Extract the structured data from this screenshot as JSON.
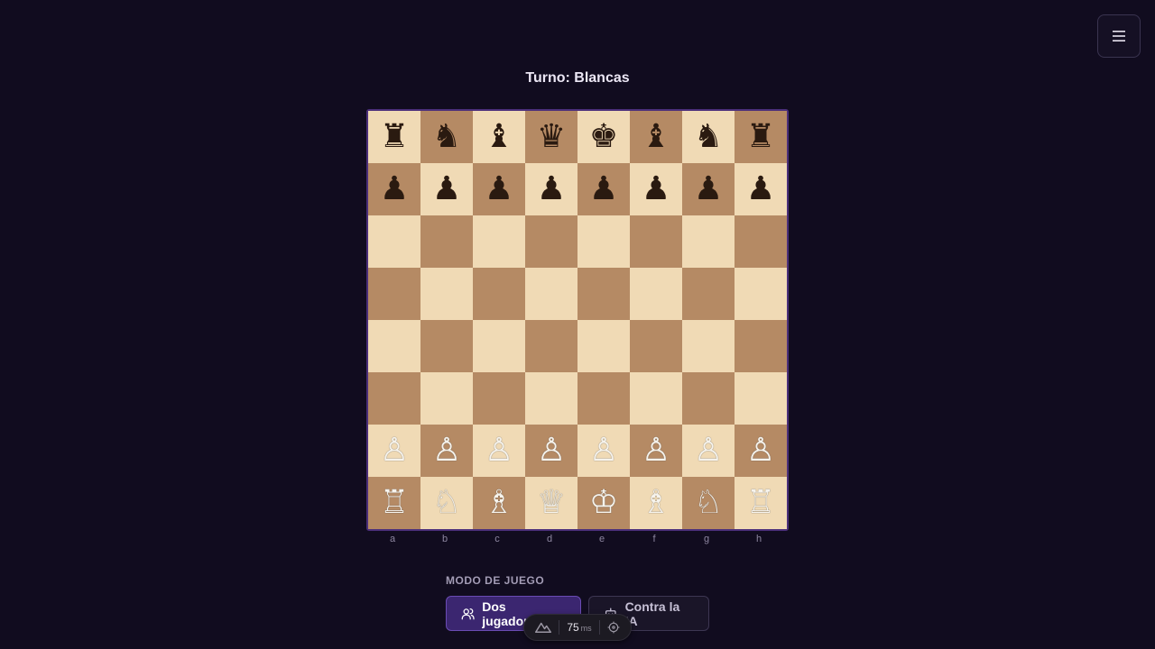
{
  "header": {
    "turn_label": "Turno: Blancas",
    "menu_icon": "hamburger-menu-icon"
  },
  "board": {
    "ranks": [
      [
        "♜",
        "♞",
        "♝",
        "♛",
        "♚",
        "♝",
        "♞",
        "♜"
      ],
      [
        "♟",
        "♟",
        "♟",
        "♟",
        "♟",
        "♟",
        "♟",
        "♟"
      ],
      [
        "",
        "",
        "",
        "",
        "",
        "",
        "",
        ""
      ],
      [
        "",
        "",
        "",
        "",
        "",
        "",
        "",
        ""
      ],
      [
        "",
        "",
        "",
        "",
        "",
        "",
        "",
        ""
      ],
      [
        "",
        "",
        "",
        "",
        "",
        "",
        "",
        ""
      ],
      [
        "♙",
        "♙",
        "♙",
        "♙",
        "♙",
        "♙",
        "♙",
        "♙"
      ],
      [
        "♖",
        "♘",
        "♗",
        "♕",
        "♔",
        "♗",
        "♘",
        "♖"
      ]
    ],
    "piece_colors": [
      [
        "black",
        "black",
        "black",
        "black",
        "black",
        "black",
        "black",
        "black"
      ],
      [
        "black",
        "black",
        "black",
        "black",
        "black",
        "black",
        "black",
        "black"
      ],
      [
        "",
        "",
        "",
        "",
        "",
        "",
        "",
        ""
      ],
      [
        "",
        "",
        "",
        "",
        "",
        "",
        "",
        ""
      ],
      [
        "",
        "",
        "",
        "",
        "",
        "",
        "",
        ""
      ],
      [
        "",
        "",
        "",
        "",
        "",
        "",
        "",
        ""
      ],
      [
        "white",
        "white",
        "white",
        "white",
        "white",
        "white",
        "white",
        "white"
      ],
      [
        "white",
        "white",
        "white",
        "white",
        "white",
        "white",
        "white",
        "white"
      ]
    ],
    "files": [
      "a",
      "b",
      "c",
      "d",
      "e",
      "f",
      "g",
      "h"
    ],
    "colors": {
      "light": "#f0dab5",
      "dark": "#b58a64",
      "border": "#4b2f7a"
    }
  },
  "mode": {
    "label": "MODO DE JUEGO",
    "two_players": "Dos jugadores",
    "vs_ai": "Contra la IA",
    "two_players_icon": "users-icon",
    "vs_ai_icon": "robot-icon"
  },
  "perf": {
    "value": "75",
    "unit": "ms",
    "left_icon": "mountain-icon",
    "right_icon": "crosshair-icon"
  }
}
